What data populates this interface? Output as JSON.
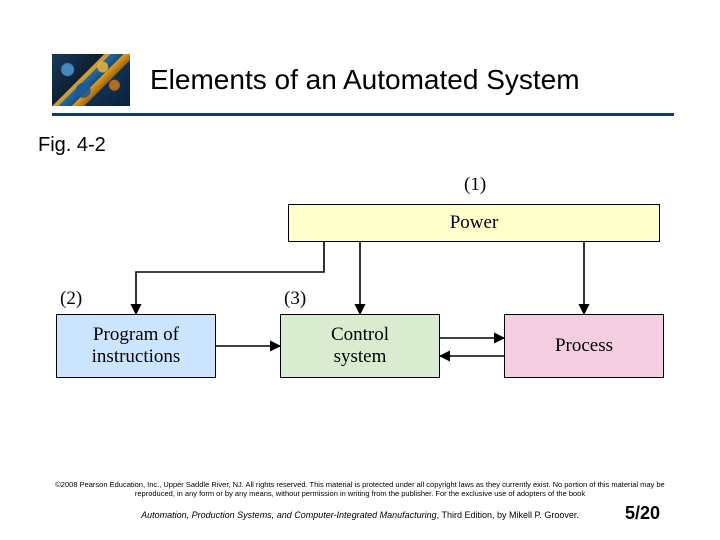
{
  "title": "Elements of an Automated System",
  "figure_label": "Fig. 4-2",
  "diagram": {
    "labels": {
      "n1": "(1)",
      "n2": "(2)",
      "n3": "(3)"
    },
    "boxes": {
      "power": {
        "text": "Power"
      },
      "program": {
        "text": "Program of\ninstructions"
      },
      "control": {
        "text": "Control\nsystem"
      },
      "process": {
        "text": "Process"
      }
    }
  },
  "footer": {
    "copyright": "©2008 Pearson Education, Inc., Upper Saddle River, NJ. All rights reserved. This material is protected under all copyright laws as they currently exist. No portion of this material may be reproduced, in any form or by any means, without permission in writing from the publisher. For the exclusive use of adopters of the book",
    "book_title": "Automation, Production Systems, and Computer-Integrated Manufacturing",
    "book_rest": ", Third Edition, by Mikell P. Groover.",
    "page": "5/20"
  },
  "chart_data": {
    "type": "diagram",
    "title": "Elements of an Automated System",
    "nodes": [
      {
        "id": "power",
        "label": "Power",
        "tag": "(1)"
      },
      {
        "id": "program",
        "label": "Program of instructions",
        "tag": "(2)"
      },
      {
        "id": "control",
        "label": "Control system",
        "tag": "(3)"
      },
      {
        "id": "process",
        "label": "Process"
      }
    ],
    "edges": [
      {
        "from": "power",
        "to": "program",
        "dir": "forward"
      },
      {
        "from": "power",
        "to": "control",
        "dir": "forward"
      },
      {
        "from": "power",
        "to": "process",
        "dir": "forward"
      },
      {
        "from": "program",
        "to": "control",
        "dir": "forward"
      },
      {
        "from": "control",
        "to": "process",
        "dir": "both"
      }
    ]
  }
}
